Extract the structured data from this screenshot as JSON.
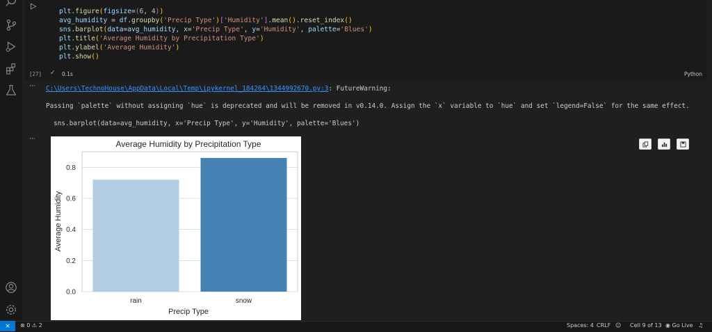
{
  "cell": {
    "exec_count": "[27]",
    "exec_time": "0.1s",
    "language": "Python",
    "run_glyph": "▷",
    "check_glyph": "✓"
  },
  "output": {
    "ellipsis1": "···",
    "ellipsis2": "···",
    "warning_path": "C:\\Users\\TechnoHouse\\AppData\\Local\\Temp\\ipykernel_184264\\1344992670.py:3",
    "warning_type": ": FutureWarning:",
    "warning_msg": "Passing `palette` without assigning `hue` is deprecated and will be removed in v0.14.0. Assign the `x` variable to `hue` and set `legend=False` for the same effect.",
    "warning_code": "sns.barplot(data=avg_humidity, x='Precip Type', y='Humidity', palette='Blues')"
  },
  "chart_data": {
    "type": "bar",
    "title": "Average Humidity by Precipitation Type",
    "xlabel": "Precip Type",
    "ylabel": "Average Humidity",
    "categories": [
      "rain",
      "snow"
    ],
    "values": [
      0.72,
      0.86
    ],
    "colors": [
      "#b3cde3",
      "#4682b4"
    ],
    "ylim": [
      0,
      0.9
    ],
    "yticks": [
      "0.0",
      "0.2",
      "0.4",
      "0.6",
      "0.8"
    ],
    "ytick_values": [
      0,
      0.2,
      0.4,
      0.6,
      0.8
    ],
    "grid": true
  },
  "status": {
    "errors": "0",
    "warnings": "2",
    "spaces": "Spaces: 4",
    "eol": "CRLF",
    "cell_pos": "Cell 9 of 13",
    "golive": "Go Live"
  },
  "colors": {
    "accent": "#0078d4",
    "bg": "#1f1f1f"
  }
}
